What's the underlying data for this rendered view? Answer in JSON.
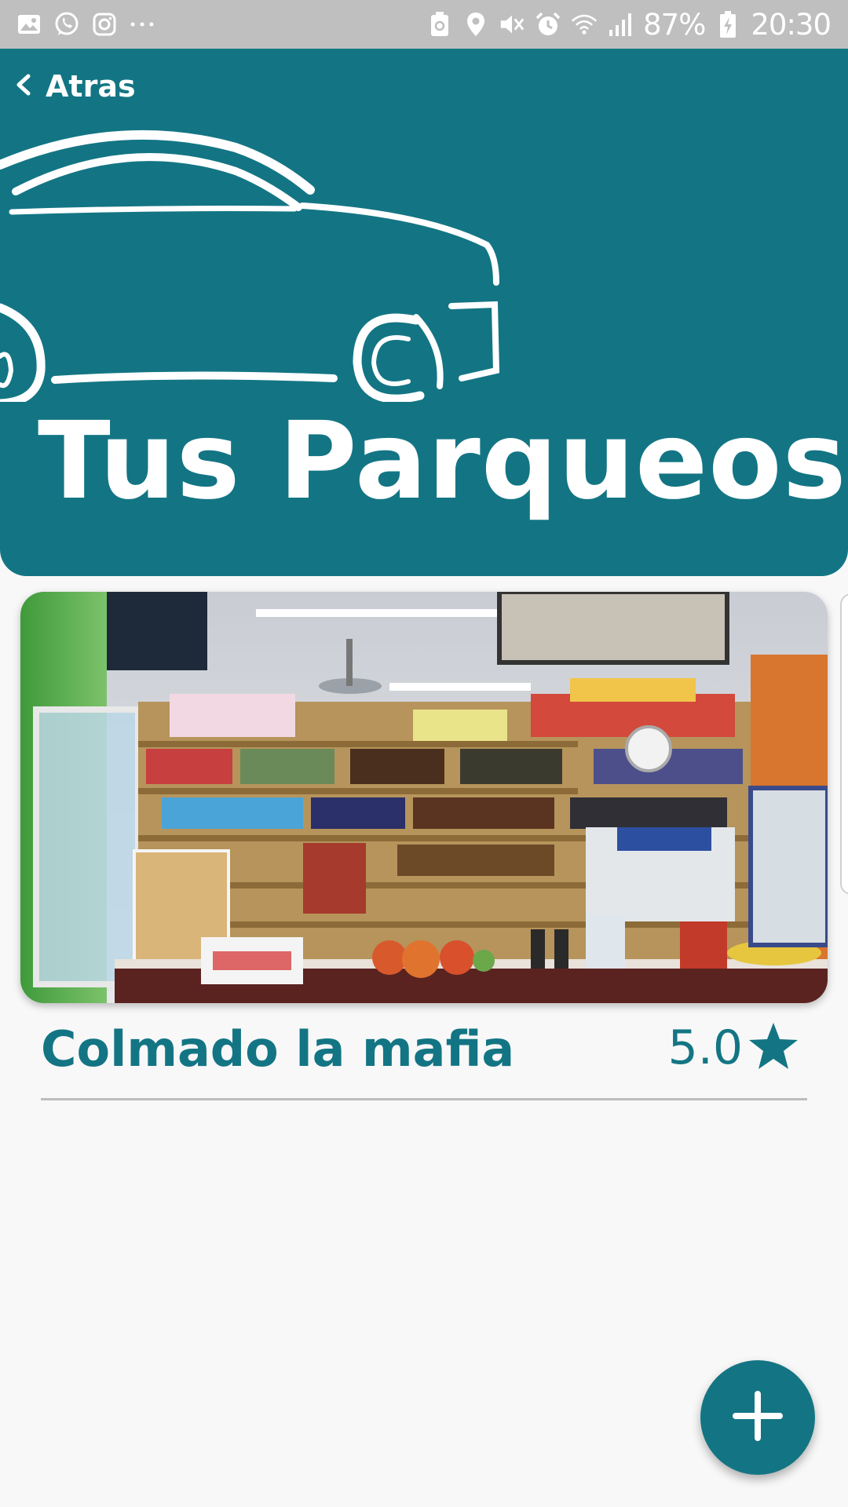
{
  "status_bar": {
    "left_icons": [
      "gallery-icon",
      "whatsapp-icon",
      "instagram-icon",
      "more-notifications-icon"
    ],
    "right_icons": [
      "recycle-icon",
      "location-icon",
      "mute-icon",
      "alarm-icon",
      "wifi-icon",
      "signal-icon"
    ],
    "battery_percent": "87%",
    "time": "20:30"
  },
  "header": {
    "back_label": "Atras",
    "title": "Tus Parqueos",
    "background_color": "#137584"
  },
  "parking_list": [
    {
      "name": "Colmado la mafia",
      "rating": "5.0",
      "rating_icon": "star-icon"
    }
  ],
  "fab": {
    "icon": "plus-icon"
  },
  "colors": {
    "accent": "#137584",
    "background": "#f8f8f8"
  }
}
